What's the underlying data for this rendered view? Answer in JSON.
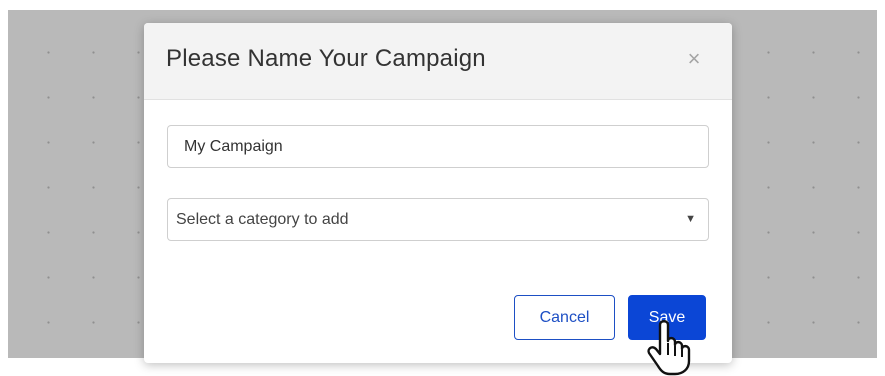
{
  "dialog": {
    "title": "Please Name Your Campaign",
    "close_glyph": "×",
    "close_icon": "close-icon"
  },
  "form": {
    "campaign_name_value": "My Campaign",
    "category_select_label": "Select a category to add",
    "category_arrow_glyph": "▼"
  },
  "actions": {
    "cancel_label": "Cancel",
    "save_label": "Save"
  },
  "cursor": {
    "icon": "hand-pointer-icon"
  },
  "colors": {
    "primary": "#0b46d6",
    "outline_button": "#1d4fc4",
    "backdrop": "#b9b9b9",
    "header_bg": "#f3f3f3"
  }
}
